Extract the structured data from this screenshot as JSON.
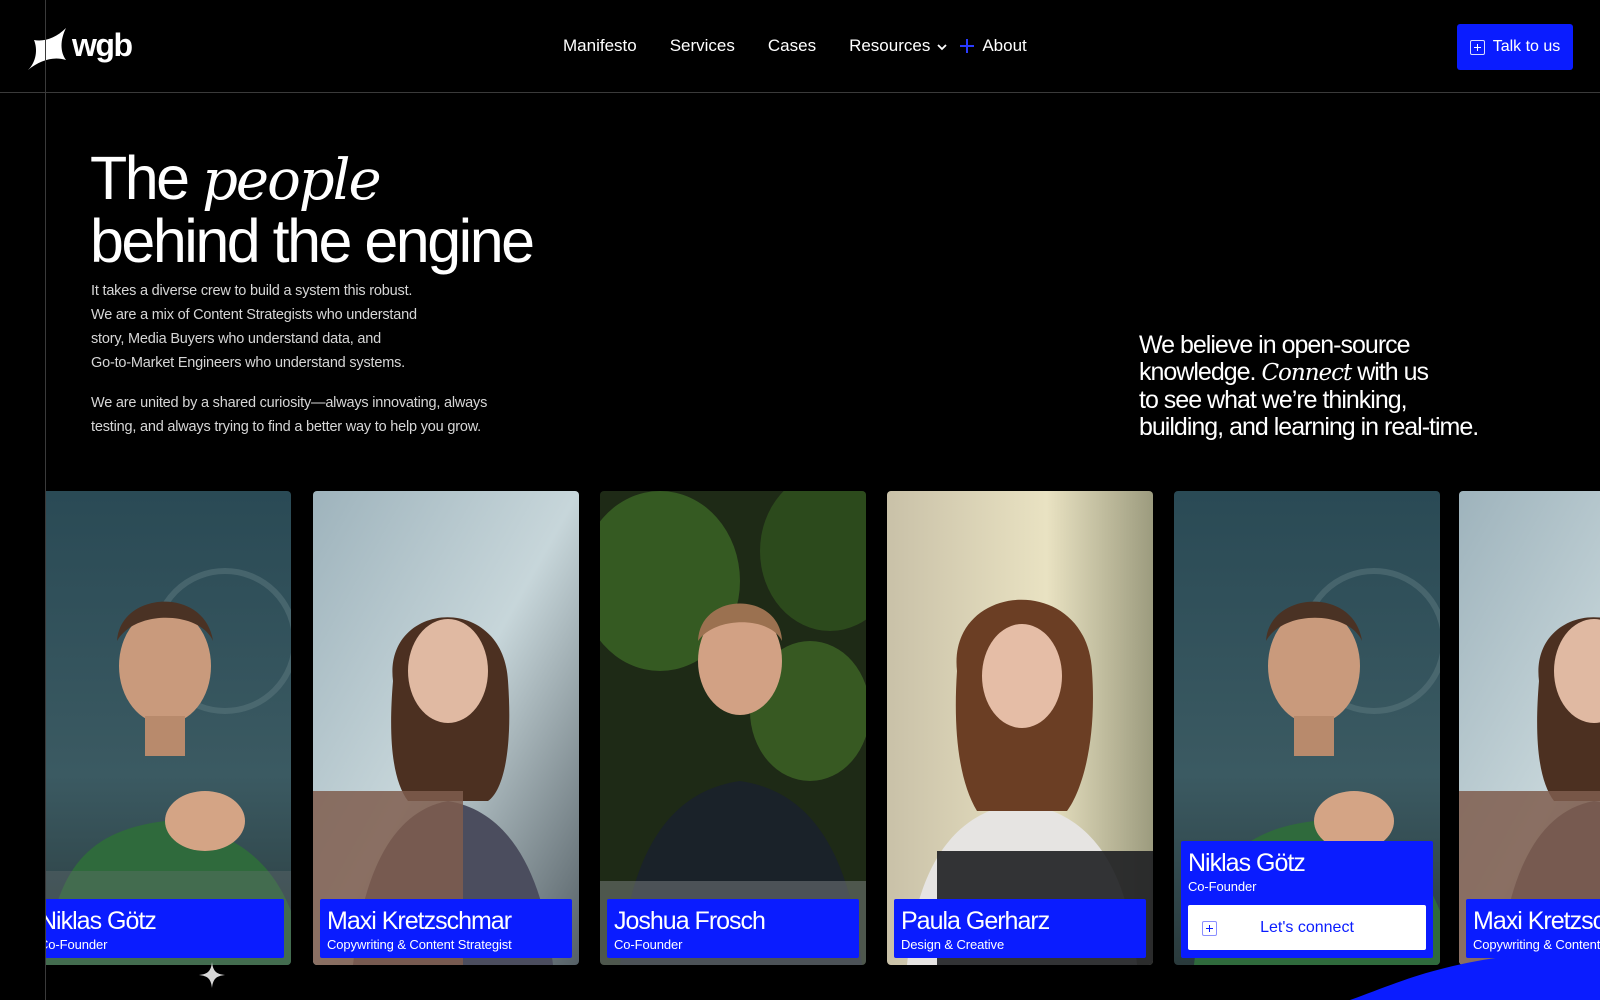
{
  "brand": {
    "name": "wgb",
    "logo_icon": "spark-flag-icon"
  },
  "nav": {
    "manifesto": "Manifesto",
    "services": "Services",
    "cases": "Cases",
    "resources": "Resources",
    "about": "About"
  },
  "cta": {
    "label": "Talk to us",
    "icon": "plus-square-icon"
  },
  "hero": {
    "title_start": "The",
    "title_em": "people",
    "title_line2": "behind the engine",
    "para1_line1": "It takes a diverse crew to build a system this robust.",
    "para1_line2": "We are a mix of Content Strategists who understand",
    "para1_line3": "story, Media Buyers who understand data, and",
    "para1_line4": "Go-to-Market Engineers who understand systems.",
    "para2_line1": "We are united by a shared curiosity—always innovating, always",
    "para2_line2": "testing, and always trying to find a better way to  help you grow."
  },
  "believe": {
    "line1": "We believe in open-source",
    "line2_start": "knowledge.",
    "line2_em": "Connect",
    "line2_end": "with us",
    "line3": "to see what we’re thinking,",
    "line4": "building, and learning in real-time."
  },
  "team": [
    {
      "name": "Niklas Götz",
      "role": "Co-Founder"
    },
    {
      "name": "Maxi Kretzschmar",
      "role": "Copywriting & Content Strategist"
    },
    {
      "name": "Joshua Frosch",
      "role": "Co-Founder"
    },
    {
      "name": "Paula Gerharz",
      "role": "Design & Creative"
    },
    {
      "name": "Niklas Götz",
      "role": "Co-Founder",
      "connect_label": "Let's connect"
    },
    {
      "name": "Maxi Kretzschmar",
      "role": "Copywriting & Content Strategist"
    }
  ],
  "colors": {
    "accent": "#0a1cff",
    "background": "#000000",
    "text": "#ffffff"
  }
}
